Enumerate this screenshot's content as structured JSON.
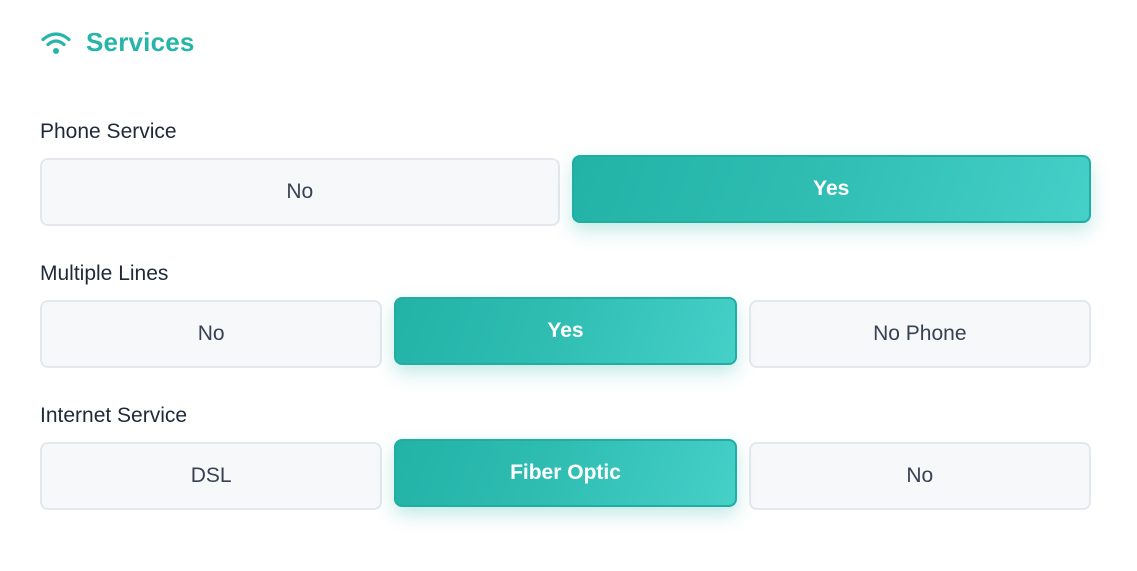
{
  "header": {
    "icon": "wifi-icon",
    "title": "Services",
    "accent_color": "#26b5a8"
  },
  "groups": [
    {
      "label": "Phone Service",
      "options": [
        {
          "label": "No",
          "selected": false
        },
        {
          "label": "Yes",
          "selected": true
        }
      ]
    },
    {
      "label": "Multiple Lines",
      "options": [
        {
          "label": "No",
          "selected": false
        },
        {
          "label": "Yes",
          "selected": true
        },
        {
          "label": "No Phone",
          "selected": false
        }
      ]
    },
    {
      "label": "Internet Service",
      "options": [
        {
          "label": "DSL",
          "selected": false
        },
        {
          "label": "Fiber Optic",
          "selected": true
        },
        {
          "label": "No",
          "selected": false
        }
      ]
    }
  ]
}
